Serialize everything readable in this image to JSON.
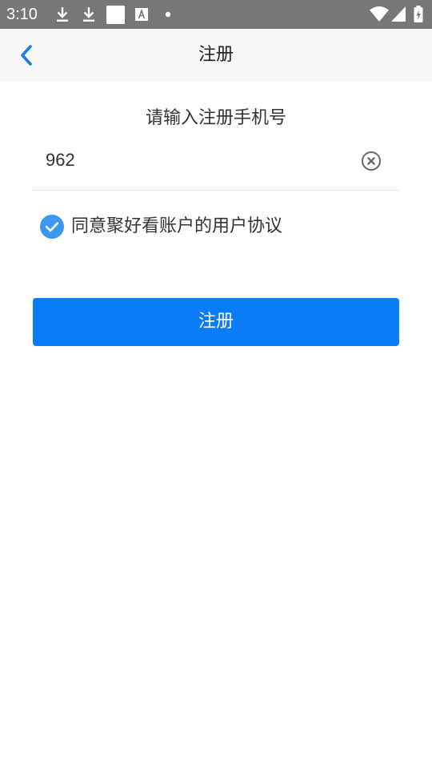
{
  "status_bar": {
    "time": "3:10",
    "icons": [
      "download-icon",
      "download-icon",
      "square-notification-icon",
      "font-notification-icon",
      "dot-icon",
      "wifi-icon",
      "signal-icon",
      "battery-charging-icon"
    ]
  },
  "app_bar": {
    "back_icon": "chevron-left-icon",
    "title": "注册"
  },
  "form": {
    "prompt": "请输入注册手机号",
    "phone_value": "962",
    "clear_icon": "clear-circle-icon",
    "agree_checked": true,
    "agree_text": "同意聚好看账户的用户协议",
    "submit_label": "注册"
  },
  "colors": {
    "status_bar": "#777777",
    "app_bar": "#f7f7f7",
    "accent": "#0a7cf7",
    "checkbox": "#3b97f2"
  }
}
